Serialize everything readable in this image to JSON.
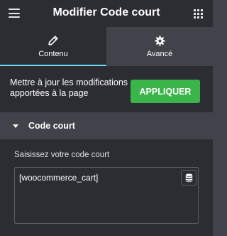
{
  "header": {
    "menu_icon": "hamburger-icon",
    "title": "Modifier Code court",
    "apps_icon": "grid-icon"
  },
  "tabs": [
    {
      "label": "Contenu",
      "icon": "pencil-icon",
      "active": true
    },
    {
      "label": "Avancé",
      "icon": "gear-icon",
      "active": false
    }
  ],
  "update_notice": {
    "text": "Mettre à jour les modifications apportées à la page",
    "button_label": "APPLIQUER"
  },
  "section": {
    "title": "Code court",
    "expanded": true
  },
  "shortcode_field": {
    "label": "Saisissez votre code court",
    "value": "[woocommerce_cart]",
    "dynamic_icon": "database-icon"
  },
  "colors": {
    "header_bg": "#2c2d33",
    "panel_bg": "#404349",
    "active_tab_indicator": "#71d7f7",
    "apply_button": "#39b54a"
  }
}
